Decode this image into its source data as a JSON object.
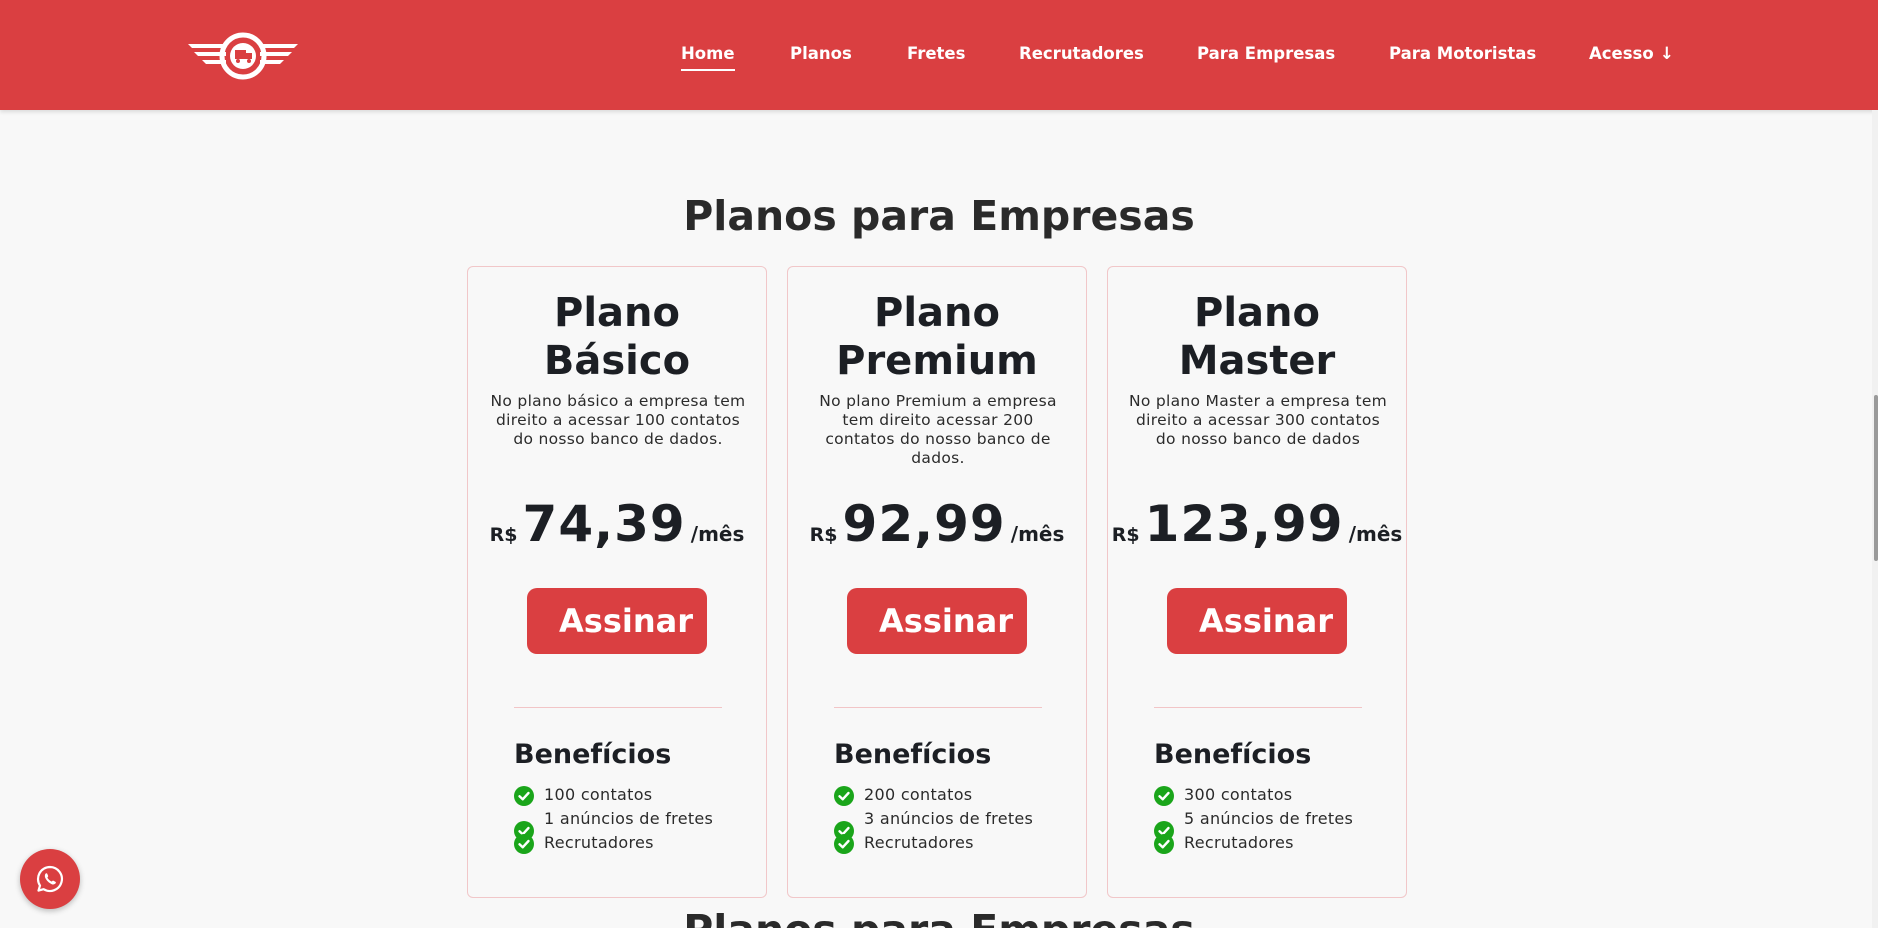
{
  "header": {
    "logo_icon": "winged-truck-logo",
    "nav": [
      {
        "label": "Home",
        "active": true
      },
      {
        "label": "Planos"
      },
      {
        "label": "Fretes"
      },
      {
        "label": "Recrutadores"
      },
      {
        "label": "Para Empresas"
      },
      {
        "label": "Para Motoristas"
      },
      {
        "label": "Acesso",
        "icon": "arrow-down-icon"
      }
    ]
  },
  "main": {
    "title": "Planos para Empresas",
    "next_section_title": "Planos para Empresas",
    "plans": [
      {
        "title": [
          "Plano",
          "Básico"
        ],
        "description": "No plano básico a empresa tem direito a acessar 100 contatos do nosso banco de dados.",
        "currency": "R$",
        "price": "74,39",
        "period": "/mês",
        "button": "Assinar",
        "benefits_title": "Benefícios",
        "benefits": [
          "100 contatos",
          "1 anúncios de fretes",
          "Recrutadores"
        ]
      },
      {
        "title": [
          "Plano",
          "Premium"
        ],
        "description": "No plano Premium a empresa tem direito acessar 200 contatos do nosso banco de dados.",
        "currency": "R$",
        "price": "92,99",
        "period": "/mês",
        "button": "Assinar",
        "benefits_title": "Benefícios",
        "benefits": [
          "200 contatos",
          "3 anúncios de fretes",
          "Recrutadores"
        ]
      },
      {
        "title": [
          "Plano",
          "Master"
        ],
        "description": "No plano Master a empresa tem direito a acessar 300 contatos do nosso banco de dados",
        "currency": "R$",
        "price": "123,99",
        "period": "/mês",
        "button": "Assinar",
        "benefits_title": "Benefícios",
        "benefits": [
          "300 contatos",
          "5 anúncios de fretes",
          "Recrutadores"
        ]
      }
    ]
  },
  "floating": {
    "whatsapp_icon": "whatsapp-icon"
  },
  "colors": {
    "brand": "#da3f41",
    "check": "#1aa51a",
    "text": "#1c1f24"
  }
}
